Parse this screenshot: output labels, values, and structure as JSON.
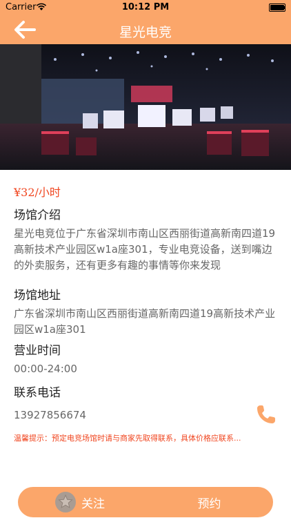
{
  "status_bar": {
    "carrier": "Carrier",
    "time": "10:12 PM"
  },
  "nav": {
    "title": "星光电竞"
  },
  "venue": {
    "price": "¥32/小时",
    "intro_title": "场馆介绍",
    "intro_text": "星光电竞位于广东省深圳市南山区西丽街道高新南四道19高新技术产业园区w1a座301，专业电竞设备，送到嘴边的外卖服务，还有更多有趣的事情等你来发现",
    "address_title": "场馆地址",
    "address_text": "广东省深圳市南山区西丽街道高新南四道19高新技术产业园区w1a座301",
    "hours_title": "营业时间",
    "hours_text": "00:00-24:00",
    "phone_title": "联系电话",
    "phone_text": "13927856674",
    "tip": "温馨提示：预定电竞场馆时请与商家先取得联系，具体价格应联系..."
  },
  "actions": {
    "follow_label": "关注",
    "book_label": "预约"
  },
  "colors": {
    "accent": "#fba66a",
    "price": "#f0451f"
  }
}
